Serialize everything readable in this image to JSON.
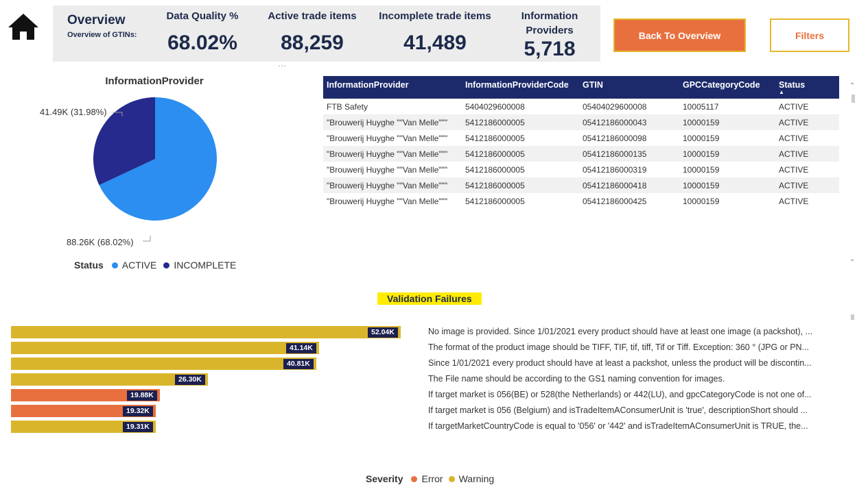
{
  "header": {
    "overview_title": "Overview",
    "overview_subtitle": "Overview of GTINs:",
    "kpis": [
      {
        "label": "Data Quality %",
        "value": "68.02%"
      },
      {
        "label": "Active trade items",
        "value": "88,259"
      },
      {
        "label": "Incomplete trade items",
        "value": "41,489"
      },
      {
        "label": "Information Providers",
        "value": "5,718"
      }
    ],
    "dots": "...",
    "back_button": "Back To Overview",
    "filters_button": "Filters"
  },
  "pie": {
    "title": "InformationProvider",
    "label_incomplete": "41.49K (31.98%)",
    "label_active": "88.26K (68.02%)",
    "legend_title": "Status",
    "legend": [
      {
        "name": "ACTIVE",
        "color": "#2b8ef0"
      },
      {
        "name": "INCOMPLETE",
        "color": "#252a8c"
      }
    ]
  },
  "chart_data": [
    {
      "type": "pie",
      "title": "InformationProvider",
      "categories": [
        "ACTIVE",
        "INCOMPLETE"
      ],
      "values": [
        88.26,
        41.49
      ],
      "percentages": [
        68.02,
        31.98
      ],
      "unit": "K",
      "legend_title": "Status"
    },
    {
      "type": "bar",
      "title": "Validation Failures",
      "orientation": "horizontal",
      "categories": [
        "No image is provided. Since 1/01/2021 every product should have at least one image (a packshot), ...",
        "The format of the product image should be TIFF, TIF, tif, tiff, Tif or Tiff. Exception: 360 ° (JPG or PN...",
        "Since 1/01/2021 every product should have at least a packshot, unless the product will be discontin...",
        "The File name should be according to the GS1 naming convention for images.",
        "If target market is 056(BE) or 528(the Netherlands) or 442(LU), and gpcCategoryCode is not one of...",
        "If target market is 056 (Belgium) and isTradeItemAConsumerUnit is 'true', descriptionShort should ...",
        "If targetMarketCountryCode is equal to '056' or '442' and isTradeItemAConsumerUnit is TRUE, the..."
      ],
      "values": [
        52040,
        41140,
        40810,
        26300,
        19880,
        19320,
        19310
      ],
      "data_labels": [
        "52.04K",
        "41.14K",
        "40.81K",
        "26.30K",
        "19.88K",
        "19.32K",
        "19.31K"
      ],
      "severity": [
        "Warning",
        "Warning",
        "Warning",
        "Warning",
        "Error",
        "Error",
        "Warning"
      ],
      "legend_title": "Severity",
      "legend": [
        {
          "name": "Error",
          "color": "#e8703f"
        },
        {
          "name": "Warning",
          "color": "#d9b52c"
        }
      ]
    }
  ],
  "table": {
    "columns": [
      "InformationProvider",
      "InformationProviderCode",
      "GTIN",
      "GPCCategoryCode",
      "Status"
    ],
    "sort_indicator": "▲",
    "rows": [
      [
        "FTB Safety",
        "5404029600008",
        "05404029600008",
        "10005117",
        "ACTIVE"
      ],
      [
        "\"Brouwerij Huyghe \"\"Van Melle\"\"\"",
        "5412186000005",
        "05412186000043",
        "10000159",
        "ACTIVE"
      ],
      [
        "\"Brouwerij Huyghe \"\"Van Melle\"\"\"",
        "5412186000005",
        "05412186000098",
        "10000159",
        "ACTIVE"
      ],
      [
        "\"Brouwerij Huyghe \"\"Van Melle\"\"\"",
        "5412186000005",
        "05412186000135",
        "10000159",
        "ACTIVE"
      ],
      [
        "\"Brouwerij Huyghe \"\"Van Melle\"\"\"",
        "5412186000005",
        "05412186000319",
        "10000159",
        "ACTIVE"
      ],
      [
        "\"Brouwerij Huyghe \"\"Van Melle\"\"\"",
        "5412186000005",
        "05412186000418",
        "10000159",
        "ACTIVE"
      ],
      [
        "\"Brouwerij Huyghe \"\"Van Melle\"\"\"",
        "5412186000005",
        "05412186000425",
        "10000159",
        "ACTIVE"
      ]
    ]
  },
  "validation": {
    "title": "Validation Failures",
    "legend_title": "Severity"
  },
  "icons": {
    "home": "home-icon",
    "scroll_up": "chevron-up-icon",
    "scroll_down": "chevron-down-icon"
  }
}
